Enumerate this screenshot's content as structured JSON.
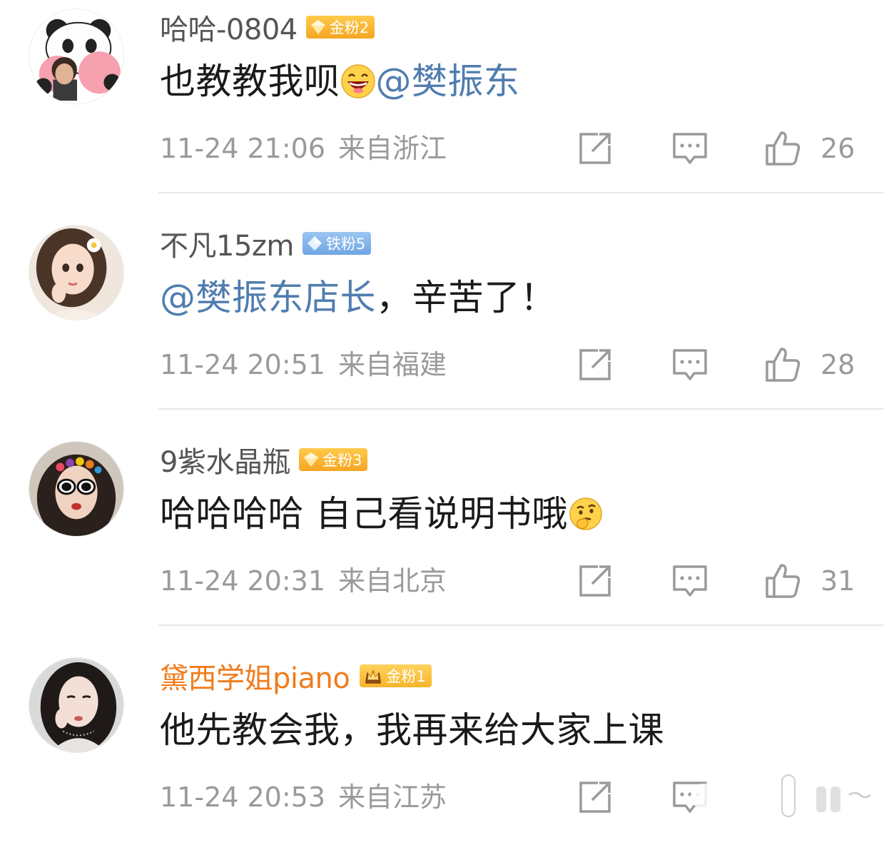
{
  "comments": [
    {
      "username": "哈哈-0804",
      "badge": "金粉2",
      "badge_type": "gold",
      "content_text": "也教教我呗",
      "emoji": "laughing-emoji",
      "mention": "@樊振东",
      "time": "11-24 21:06",
      "location": "来自浙江",
      "likes": "26"
    },
    {
      "username": "不凡15zm",
      "badge": "铁粉5",
      "badge_type": "iron",
      "mention": "@樊振东店长",
      "content_text": "，辛苦了！",
      "time": "11-24 20:51",
      "location": "来自福建",
      "likes": "28"
    },
    {
      "username": "9紫水晶瓶",
      "badge": "金粉3",
      "badge_type": "gold",
      "content_text": "哈哈哈哈 自己看说明书哦",
      "emoji": "thinking-emoji",
      "time": "11-24 20:31",
      "location": "来自北京",
      "likes": "31"
    },
    {
      "username": "黛西学姐piano",
      "username_color": "#f07c1c",
      "badge": "金粉1",
      "badge_type": "crown",
      "content_text": "他先教会我，我再来给大家上课",
      "time": "11-24 20:53",
      "location": "来自江苏"
    }
  ],
  "colors": {
    "mention": "#507daf",
    "meta": "#9a9a9a",
    "gold_badge": "#f5a623",
    "iron_badge": "#6ea6e4"
  },
  "icons": {
    "share": "share-icon",
    "reply": "comment-icon",
    "like": "thumbs-up-icon"
  }
}
